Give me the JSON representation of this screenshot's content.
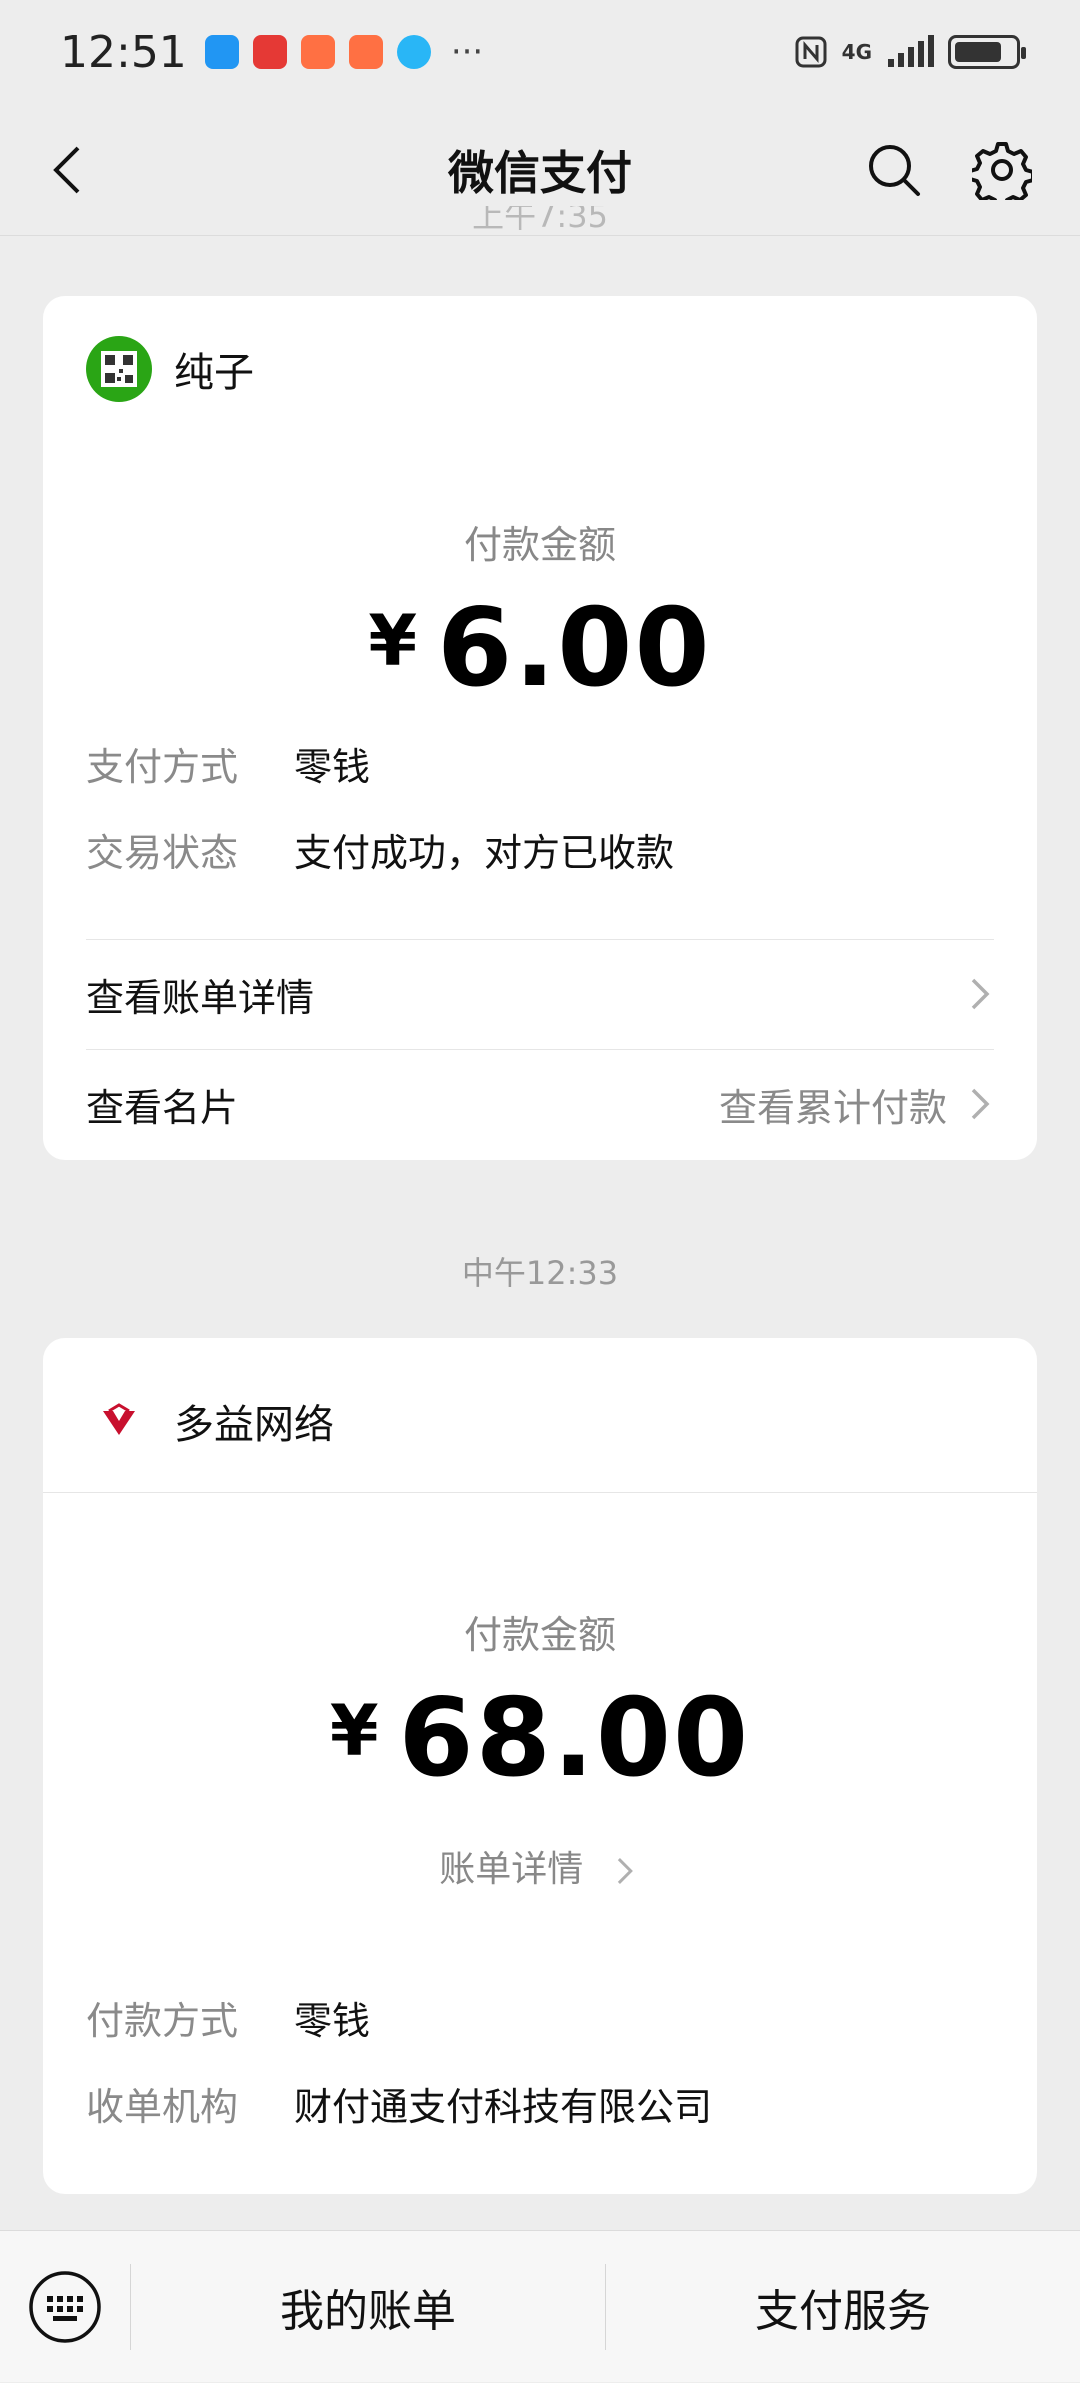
{
  "status_bar": {
    "time": "12:51",
    "more": "···",
    "network": "4G",
    "battery_level": 0.7
  },
  "nav": {
    "title": "微信支付"
  },
  "cut_time": "上午7:35",
  "card1": {
    "merchant": "纯子",
    "amount_label": "付款金额",
    "currency": "¥",
    "amount": "6.00",
    "rows": [
      {
        "key": "支付方式",
        "value": "零钱"
      },
      {
        "key": "交易状态",
        "value": "支付成功，对方已收款"
      }
    ],
    "links": {
      "bill_detail": "查看账单详情",
      "card": "查看名片",
      "cumulative": "查看累计付款"
    }
  },
  "section_time": "中午12:33",
  "card2": {
    "merchant": "多益网络",
    "amount_label": "付款金额",
    "currency": "¥",
    "amount": "68.00",
    "bill_link": "账单详情",
    "rows": [
      {
        "key": "付款方式",
        "value": "零钱"
      },
      {
        "key": "收单机构",
        "value": "财付通支付科技有限公司"
      }
    ]
  },
  "bottom": {
    "my_bills": "我的账单",
    "pay_services": "支付服务"
  },
  "colors": {
    "background": "#ededed",
    "card": "#ffffff",
    "muted_text": "#8a8a8a",
    "wechat_green": "#2aa515",
    "merchant_red": "#c8102e"
  }
}
